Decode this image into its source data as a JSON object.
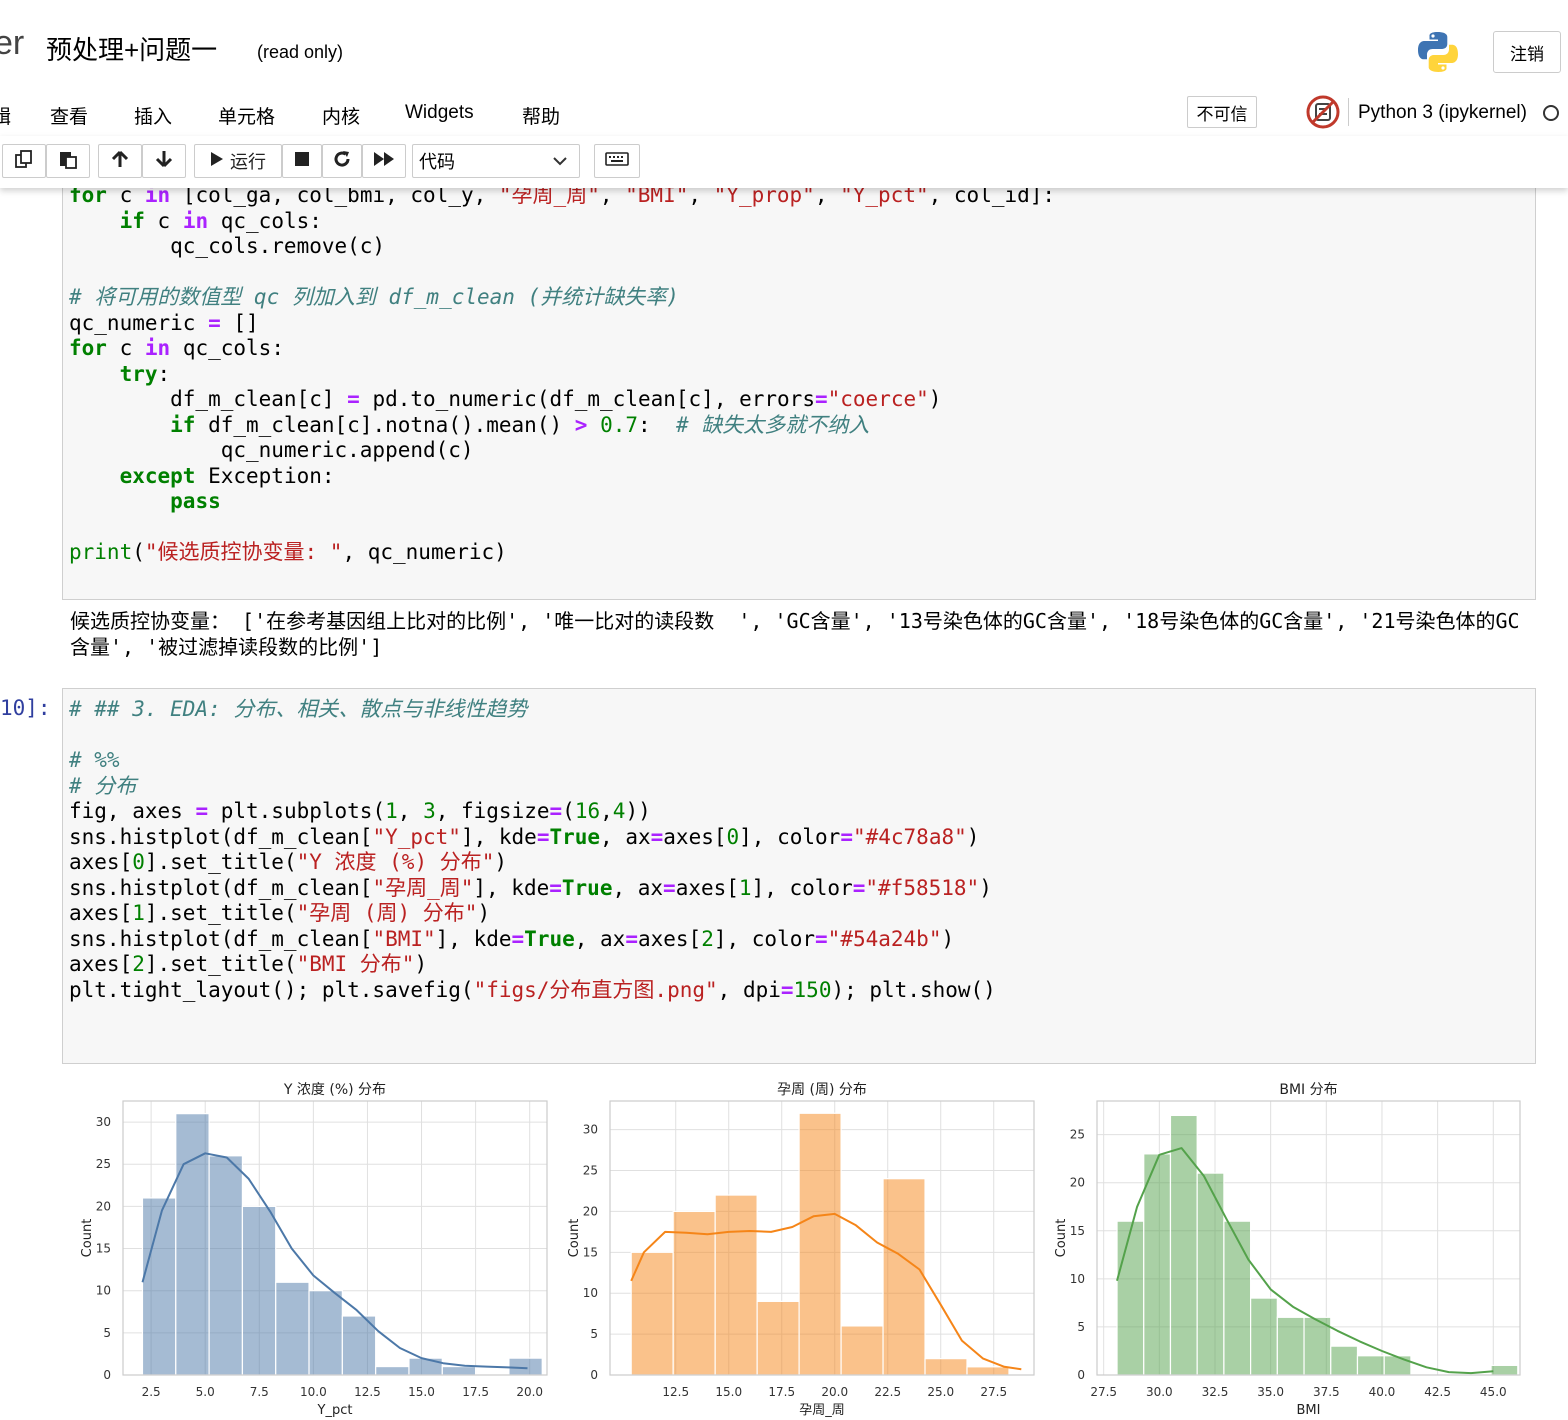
{
  "header": {
    "logo_fragment": "er",
    "notebook_title": "预处理+问题一",
    "read_only": "(read only)",
    "logout": "注销"
  },
  "menu": {
    "items": [
      "辑",
      "查看",
      "插入",
      "单元格",
      "内核",
      "Widgets",
      "帮助"
    ],
    "trust": "不可信",
    "kernel_name": "Python 3 (ipykernel)"
  },
  "toolbar": {
    "run": "运行",
    "cell_type": "代码"
  },
  "icons": {
    "copy": "copy-icon",
    "paste": "paste-icon",
    "up": "arrow-up-icon",
    "down": "arrow-down-icon",
    "run": "play-icon",
    "stop": "stop-icon",
    "restart": "restart-icon",
    "fast_forward": "fast-forward-icon",
    "keyboard": "keyboard-icon",
    "kernel": "kernel-not-trusted-icon"
  },
  "cells": {
    "first_output": "候选质控协变量： ['在参考基因组上比对的比例', '唯一比对的读段数  ', 'GC含量', '13号染色体的GC含量', '18号染色体的GC含量', '21号染色体的GC含量', '被过滤掉读段数的比例']",
    "second_prompt": "10]:"
  },
  "chart_data": [
    {
      "type": "bar",
      "title": "Y 浓度 (%) 分布",
      "xlabel": "Y_pct",
      "ylabel": "Count",
      "color": "#4c78a8",
      "xlim": [
        1.2,
        20.8
      ],
      "ylim": [
        0,
        32.5
      ],
      "xticks": [
        2.5,
        5.0,
        7.5,
        10.0,
        12.5,
        15.0,
        17.5,
        20.0
      ],
      "yticks": [
        0,
        5,
        10,
        15,
        20,
        25,
        30
      ],
      "bin_edges": [
        2.1,
        3.64,
        5.18,
        6.72,
        8.26,
        9.8,
        11.34,
        12.88,
        14.42,
        15.96,
        17.5,
        19.04,
        20.58
      ],
      "counts": [
        21,
        31,
        26,
        20,
        11,
        10,
        7,
        1,
        2,
        1,
        0,
        2
      ],
      "kde_x": [
        2.1,
        3.0,
        4.0,
        5.0,
        6.0,
        7.0,
        8.0,
        9.0,
        10.0,
        11.0,
        12.0,
        13.0,
        14.0,
        15.0,
        16.0,
        17.0,
        18.0,
        19.0,
        19.9
      ],
      "kde_y": [
        11.0,
        19.5,
        25.0,
        26.3,
        25.8,
        23.3,
        19.4,
        15.0,
        11.8,
        9.7,
        7.7,
        5.2,
        3.2,
        2.0,
        1.4,
        1.1,
        1.0,
        0.9,
        0.8
      ]
    },
    {
      "type": "bar",
      "title": "孕周 (周) 分布",
      "xlabel": "孕周_周",
      "ylabel": "Count",
      "color": "#f58518",
      "xlim": [
        9.4,
        29.4
      ],
      "ylim": [
        0,
        33.5
      ],
      "xticks": [
        12.5,
        15.0,
        17.5,
        20.0,
        22.5,
        25.0,
        27.5
      ],
      "yticks": [
        0,
        5,
        10,
        15,
        20,
        25,
        30
      ],
      "bin_edges": [
        10.4,
        12.38,
        14.36,
        16.34,
        18.32,
        20.3,
        22.28,
        24.26,
        26.24,
        28.22
      ],
      "counts": [
        15,
        20,
        22,
        9,
        32,
        6,
        24,
        2,
        1
      ],
      "kde_x": [
        10.4,
        11.0,
        12.0,
        13.0,
        14.0,
        15.0,
        16.0,
        17.0,
        18.0,
        19.0,
        20.0,
        21.0,
        22.0,
        23.0,
        24.0,
        25.0,
        26.0,
        27.0,
        28.0,
        28.8
      ],
      "kde_y": [
        11.5,
        15.0,
        17.5,
        17.4,
        17.2,
        17.5,
        17.6,
        17.5,
        18.1,
        19.4,
        19.7,
        18.3,
        16.2,
        14.8,
        12.9,
        8.6,
        4.2,
        2.0,
        1.0,
        0.7
      ]
    },
    {
      "type": "bar",
      "title": "BMI 分布",
      "xlabel": "BMI",
      "ylabel": "Count",
      "color": "#54a24b",
      "xlim": [
        27.2,
        46.2
      ],
      "ylim": [
        0,
        28.5
      ],
      "xticks": [
        27.5,
        30.0,
        32.5,
        35.0,
        37.5,
        40.0,
        42.5,
        45.0
      ],
      "yticks": [
        0,
        5,
        10,
        15,
        20,
        25
      ],
      "bin_edges": [
        28.1,
        29.3,
        30.5,
        31.7,
        32.9,
        34.1,
        35.3,
        36.5,
        37.7,
        38.9,
        40.1,
        41.3,
        42.5,
        43.7,
        44.9,
        46.1
      ],
      "counts": [
        16,
        23,
        27,
        21,
        16,
        8,
        6,
        6,
        3,
        2,
        2,
        0,
        0,
        0,
        1
      ],
      "kde_x": [
        28.1,
        29.0,
        30.0,
        31.0,
        32.0,
        33.0,
        34.0,
        35.0,
        36.0,
        37.0,
        38.0,
        39.0,
        40.0,
        41.0,
        42.0,
        43.0,
        44.0,
        45.0
      ],
      "kde_y": [
        9.8,
        17.5,
        22.9,
        23.6,
        20.7,
        16.3,
        12.0,
        8.9,
        7.1,
        5.8,
        4.6,
        3.5,
        2.5,
        1.6,
        0.8,
        0.3,
        0.2,
        0.4
      ]
    }
  ]
}
